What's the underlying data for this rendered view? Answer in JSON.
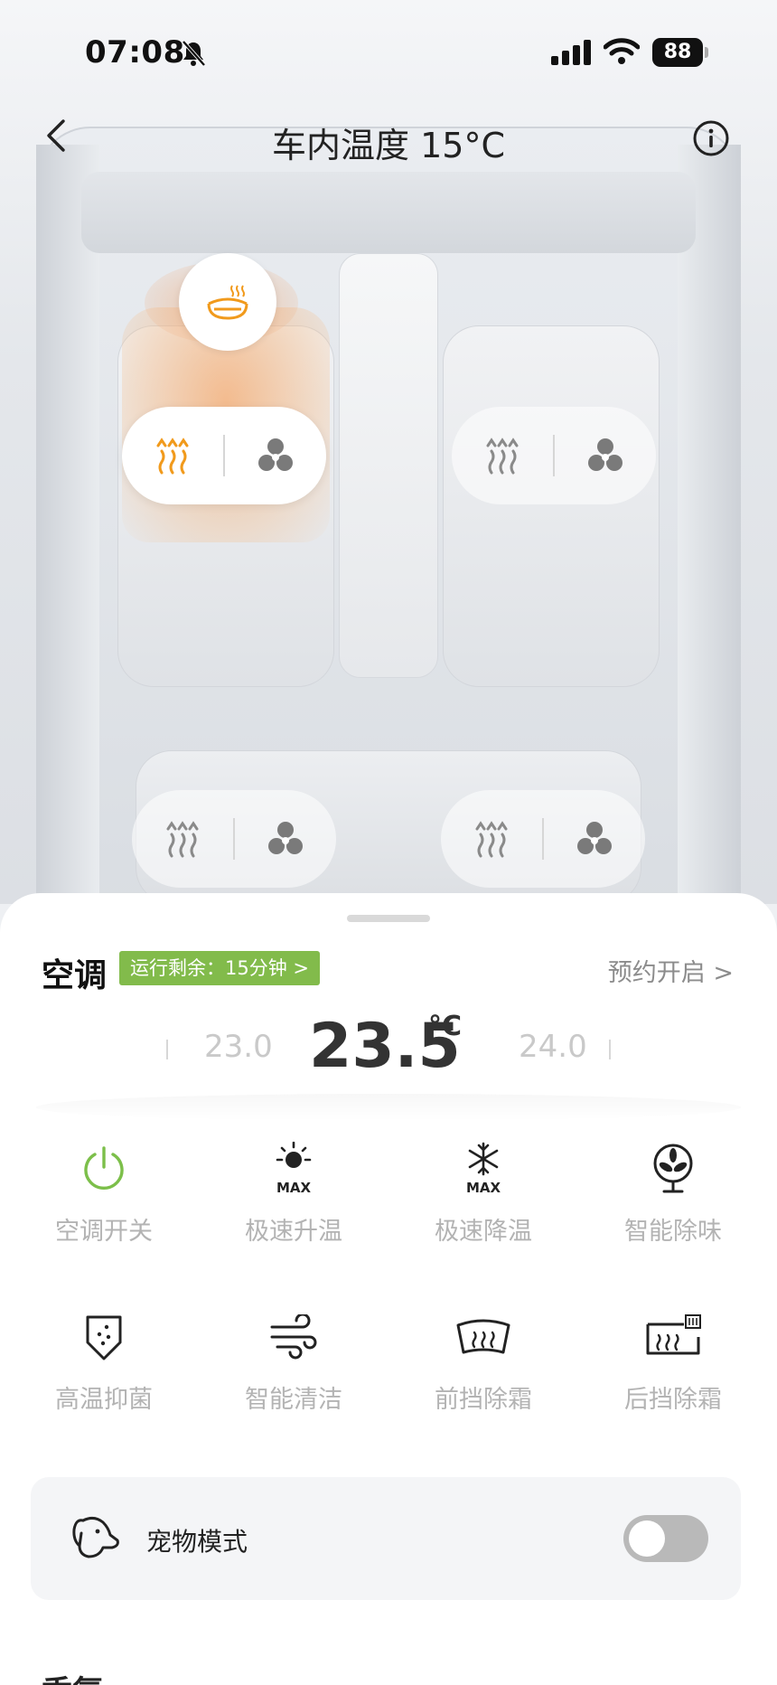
{
  "status_bar": {
    "time": "07:08",
    "battery": "88"
  },
  "header": {
    "title": "车内温度 15°C"
  },
  "ac": {
    "label": "空调",
    "badge": "运行剩余：15分钟 >",
    "schedule": "预约开启 >",
    "temp_current": "23.5",
    "temp_unit": "°C",
    "temp_prev": "23.0",
    "temp_next": "24.0"
  },
  "functions": [
    {
      "label": "空调开关",
      "icon": "power-icon"
    },
    {
      "label": "极速升温",
      "icon": "sun-max-icon"
    },
    {
      "label": "极速降温",
      "icon": "snowflake-max-icon"
    },
    {
      "label": "智能除味",
      "icon": "fan-icon"
    },
    {
      "label": "高温抑菌",
      "icon": "shield-icon"
    },
    {
      "label": "智能清洁",
      "icon": "wind-icon"
    },
    {
      "label": "前挡除霜",
      "icon": "front-defrost-icon"
    },
    {
      "label": "后挡除霜",
      "icon": "rear-defrost-icon"
    }
  ],
  "pet_mode": {
    "label": "宠物模式",
    "enabled": false
  },
  "next_section": "香氛",
  "colors": {
    "accent_orange": "#f19a1c",
    "badge_green": "#82bb4b",
    "power_green": "#7cbf4a"
  }
}
